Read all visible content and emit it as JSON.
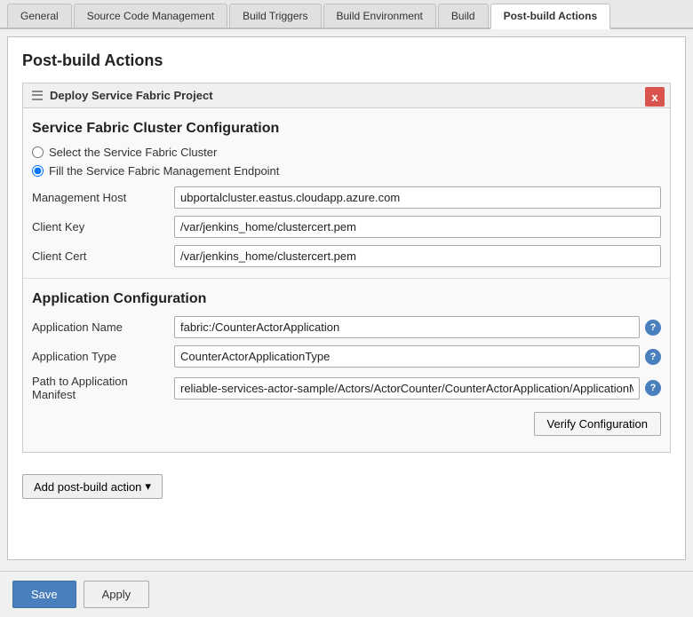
{
  "tabs": [
    {
      "id": "general",
      "label": "General",
      "active": false
    },
    {
      "id": "scm",
      "label": "Source Code Management",
      "active": false
    },
    {
      "id": "build-triggers",
      "label": "Build Triggers",
      "active": false
    },
    {
      "id": "build-env",
      "label": "Build Environment",
      "active": false
    },
    {
      "id": "build",
      "label": "Build",
      "active": false
    },
    {
      "id": "post-build",
      "label": "Post-build Actions",
      "active": true
    }
  ],
  "page": {
    "title": "Post-build Actions"
  },
  "deploy_panel": {
    "title": "Deploy Service Fabric Project",
    "close_label": "x"
  },
  "cluster_config": {
    "section_title": "Service Fabric Cluster Configuration",
    "radio_select": "Select the Service Fabric Cluster",
    "radio_fill": "Fill the Service Fabric Management Endpoint",
    "fields": [
      {
        "label": "Management Host",
        "value": "ubportalcluster.eastus.cloudapp.azure.com",
        "name": "management-host-input"
      },
      {
        "label": "Client Key",
        "value": "/var/jenkins_home/clustercert.pem",
        "name": "client-key-input"
      },
      {
        "label": "Client Cert",
        "value": "/var/jenkins_home/clustercert.pem",
        "name": "client-cert-input"
      }
    ]
  },
  "app_config": {
    "section_title": "Application Configuration",
    "fields": [
      {
        "label": "Application Name",
        "value": "fabric:/CounterActorApplication",
        "name": "app-name-input",
        "has_help": true
      },
      {
        "label": "Application Type",
        "value": "CounterActorApplicationType",
        "name": "app-type-input",
        "has_help": true
      },
      {
        "label": "Path to Application Manifest",
        "value": "reliable-services-actor-sample/Actors/ActorCounter/CounterActorApplication/ApplicationManifes",
        "name": "app-manifest-input",
        "has_help": true
      }
    ],
    "verify_btn": "Verify Configuration"
  },
  "add_action_btn": "Add post-build action",
  "footer": {
    "save_label": "Save",
    "apply_label": "Apply"
  }
}
